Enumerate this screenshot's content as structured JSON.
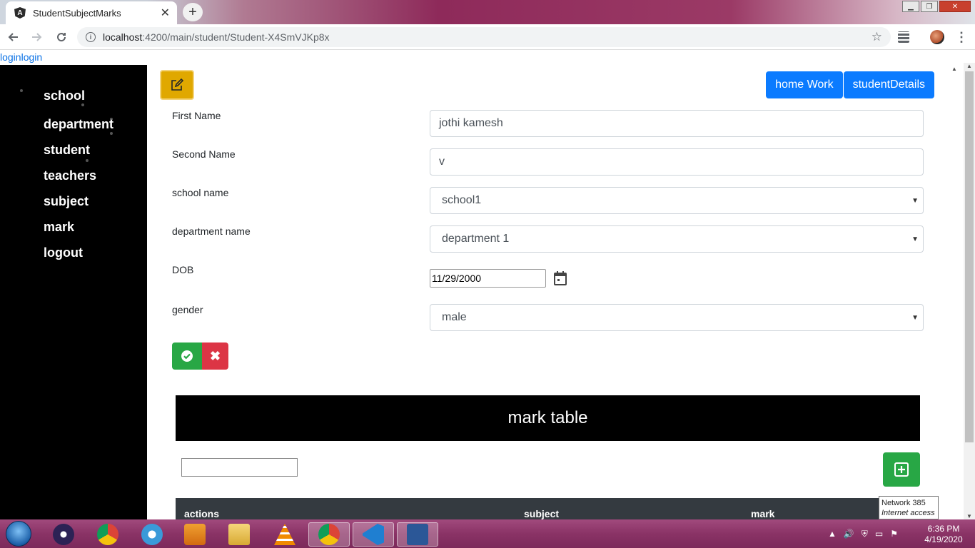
{
  "browser": {
    "tab_title": "StudentSubjectMarks",
    "tab_close": "✕",
    "new_tab": "+",
    "url_host": "localhost",
    "url_path": ":4200/main/student/Student-X4SmVJKp8x"
  },
  "page": {
    "top_link": "loginlogin"
  },
  "sidebar": {
    "items": [
      {
        "label": "school"
      },
      {
        "label": "department"
      },
      {
        "label": "student"
      },
      {
        "label": "teachers"
      },
      {
        "label": "subject"
      },
      {
        "label": "mark"
      },
      {
        "label": "logout"
      }
    ]
  },
  "header_buttons": {
    "home_work": "home Work",
    "student_details": "studentDetails"
  },
  "form": {
    "first_name": {
      "label": "First Name",
      "value": "jothi kamesh"
    },
    "second_name": {
      "label": "Second Name",
      "value": "v"
    },
    "school_name": {
      "label": "school name",
      "value": "school1"
    },
    "department_name": {
      "label": "department name",
      "value": "department 1"
    },
    "dob": {
      "label": "DOB",
      "value": "11/29/2000"
    },
    "gender": {
      "label": "gender",
      "value": "male"
    }
  },
  "mark_table": {
    "title": "mark table",
    "search_value": "",
    "columns": [
      "actions",
      "subject",
      "mark"
    ]
  },
  "tooltip": {
    "line1": "Network  385",
    "line2": "Internet access"
  },
  "taskbar": {
    "time": "6:36 PM",
    "date": "4/19/2020"
  },
  "colors": {
    "primary": "#0b7bff",
    "success": "#28a745",
    "danger": "#dc3545",
    "warning": "#e0a800",
    "sidebar_bg": "#000000",
    "table_header_bg": "#343a40"
  }
}
